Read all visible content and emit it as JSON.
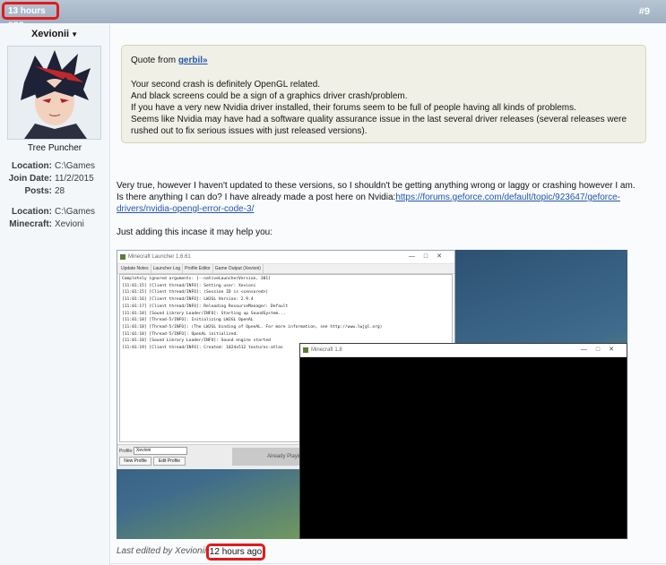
{
  "post": {
    "time_ago": "13 hours ago",
    "number": "#9"
  },
  "user": {
    "name": "Xevionii",
    "rank": "Tree Puncher",
    "stats": [
      {
        "key": "Location:",
        "value": "C:\\Games"
      },
      {
        "key": "Join Date:",
        "value": "11/2/2015"
      },
      {
        "key": "Posts:",
        "value": "28"
      }
    ],
    "stats2": [
      {
        "key": "Location:",
        "value": "C:\\Games"
      },
      {
        "key": "Minecraft:",
        "value": "Xevioni"
      }
    ]
  },
  "quote": {
    "prefix": "Quote from ",
    "author": "gerbil»",
    "lines": [
      "Your second crash is definitely OpenGL related.",
      "And black screens could be a sign of a graphics driver crash/problem.",
      "If you have a very new Nvidia driver installed, their forums seem to be full of people having all kinds of problems.",
      "Seems like Nvidia may have had a software quality assurance issue in the last several driver releases (several releases were rushed out to fix serious issues with just released versions)."
    ]
  },
  "body": {
    "para1": "Very true, however I haven't updated to these versions, so I shouldn't be getting anything wrong or laggy or crashing however I am.",
    "para2_prefix": "Is there anything I can do? I have already made a post here on Nvidia:",
    "link": "https://forums.geforce.com/default/topic/923647/geforce-drivers/nvidia-opengl-error-code-3/",
    "para3": "Just adding this incase it may help you:"
  },
  "screenshot": {
    "launcher_title": "Minecraft Launcher 1.6.61",
    "tabs": [
      "Update Notes",
      "Launcher Log",
      "Profile Editor",
      "Game Output (Xevioni)"
    ],
    "log_lines": [
      "Completely ignored arguments: [--nativeLauncherVersion, 301]",
      "[11:01:15] [Client thread/INFO]: Setting user: Xevioni",
      "[11:01:15] [Client thread/INFO]: (Session ID is <censored>)",
      "[11:01:16] [Client thread/INFO]: LWJGL Version: 2.9.4",
      "[11:01:17] [Client thread/INFO]: Reloading ResourceManager: Default",
      "[11:01:18] [Sound Library Loader/INFO]: Starting up SoundSystem...",
      "[11:01:18] [Thread-5/INFO]: Initializing LWJGL OpenAL",
      "[11:01:18] [Thread-5/INFO]: (The LWJGL binding of OpenAL.  For more information, see http://www.lwjgl.org)",
      "[11:01:18] [Thread-5/INFO]: OpenAL initialized.",
      "[11:01:18] [Sound Library Loader/INFO]: Sound engine started",
      "[11:01:19] [Client thread/INFO]: Created: 1024x512 textures-atlas"
    ],
    "profile_label": "Profile:",
    "profile_value": "Xevioni",
    "new_profile": "New Profile",
    "edit_profile": "Edit Profile",
    "play_label": "Already Playing",
    "game_title": "Minecraft 1.8"
  },
  "footer": {
    "edited_by": "Last edited by Xevionii",
    "edit_time": "12 hours ago"
  }
}
